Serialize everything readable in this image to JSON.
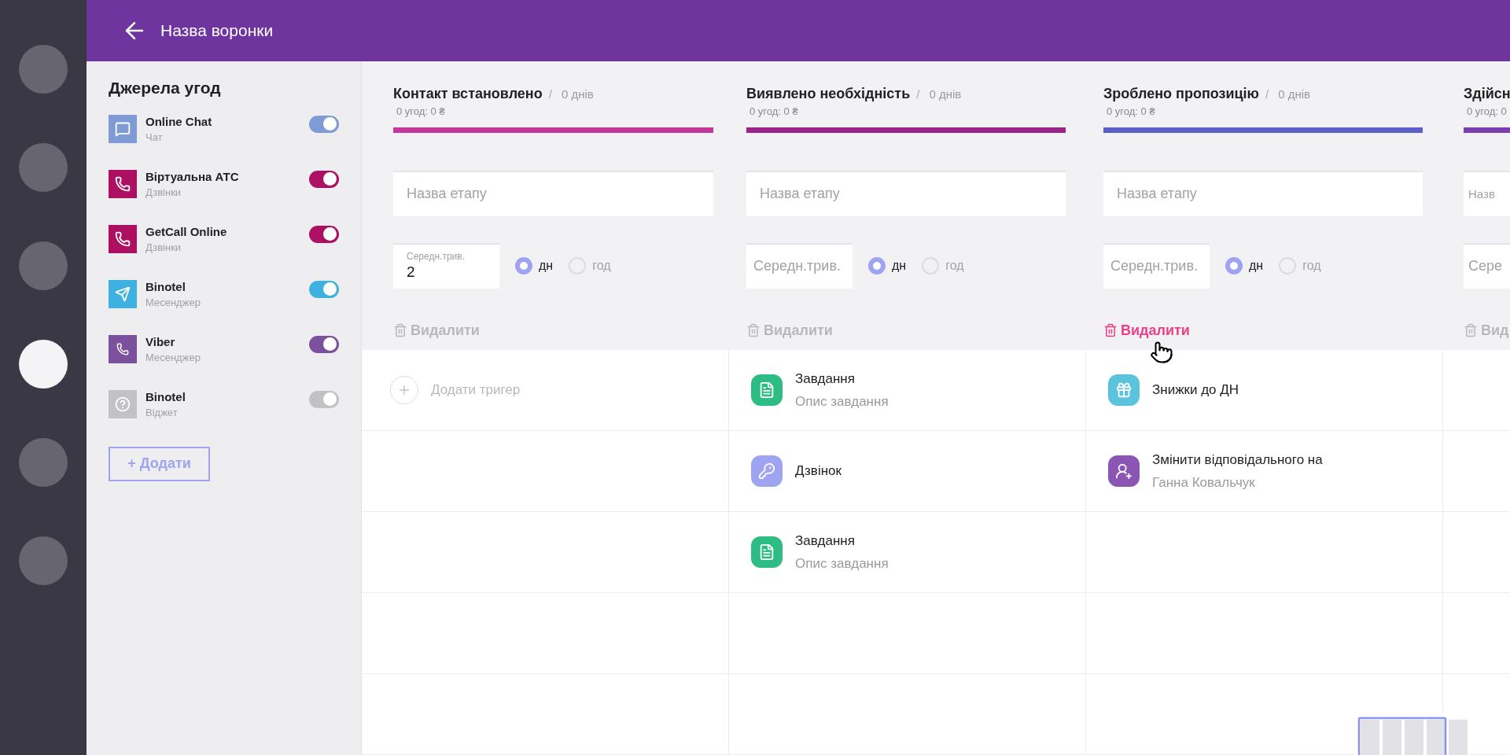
{
  "header": {
    "title": "Назва воронки"
  },
  "rail": [
    {
      "selected": false
    },
    {
      "selected": false
    },
    {
      "selected": false
    },
    {
      "selected": true
    },
    {
      "selected": false
    },
    {
      "selected": false
    }
  ],
  "sources": {
    "title": "Джерела угод",
    "items": [
      {
        "kind": "chat",
        "name": "Online Chat",
        "type": "Чат",
        "color": "#7f9bd6",
        "on": true
      },
      {
        "kind": "pbx",
        "name": "Віртуальна АТС",
        "type": "Дзвінки",
        "color": "#ad0f62",
        "on": true
      },
      {
        "kind": "phone",
        "name": "GetCall Online",
        "type": "Дзвінки",
        "color": "#ad0f62",
        "on": true
      },
      {
        "kind": "telegram",
        "name": "Binotel",
        "type": "Месенджер",
        "color": "#3eb1e0",
        "on": true
      },
      {
        "kind": "viber",
        "name": "Viber",
        "type": "Месенджер",
        "color": "#7b519d",
        "on": true
      },
      {
        "kind": "widget",
        "name": "Binotel",
        "type": "Віджет",
        "color": "#c2c2c4",
        "on": true
      }
    ],
    "add_button": "+ Додати"
  },
  "stages": [
    {
      "title": "Контакт встановлено",
      "separator": "/",
      "duration": "0 днів",
      "summary": "0 угод: 0 ₴",
      "color": "#c2399a",
      "name_placeholder": "Назва етапу",
      "duration_field": {
        "label": "Середн.трив.",
        "value": "2"
      },
      "units": [
        {
          "label": "дн",
          "selected": true
        },
        {
          "label": "год",
          "selected": false
        }
      ],
      "delete": {
        "label": "Видалити",
        "hover": false
      },
      "cards": [
        {
          "kind": "add",
          "title": "Додати тригер"
        }
      ]
    },
    {
      "title": "Виявлено необхідність",
      "separator": "/",
      "duration": "0 днів",
      "summary": "0 угод: 0 ₴",
      "color": "#9c2388",
      "name_placeholder": "Назва етапу",
      "duration_field": {
        "placeholder": "Середн.трив."
      },
      "units": [
        {
          "label": "дн",
          "selected": true
        },
        {
          "label": "год",
          "selected": false
        }
      ],
      "delete": {
        "label": "Видалити",
        "hover": false
      },
      "cards": [
        {
          "kind": "task",
          "title": "Завдання",
          "subtitle": "Опис завдання"
        },
        {
          "kind": "call",
          "title": "Дзвінок"
        },
        {
          "kind": "task",
          "title": "Завдання",
          "subtitle": "Опис завдання"
        }
      ]
    },
    {
      "title": "Зроблено пропозицію",
      "separator": "/",
      "duration": "0 днів",
      "summary": "0 угод: 0 ₴",
      "color": "#5b5fc7",
      "name_placeholder": "Назва етапу",
      "duration_field": {
        "placeholder": "Середн.трив."
      },
      "units": [
        {
          "label": "дн",
          "selected": true
        },
        {
          "label": "год",
          "selected": false
        }
      ],
      "delete": {
        "label": "Видалити",
        "hover": true
      },
      "cards": [
        {
          "kind": "gift",
          "title": "Знижки до ДН"
        },
        {
          "kind": "assign",
          "title": "Змінити відповідального на",
          "subtitle": "Ганна Ковальчук"
        }
      ]
    },
    {
      "title": "Здійсн",
      "summary": "0 угод: 0",
      "color": "#7b3fb0",
      "name_placeholder": "Назв",
      "duration_field": {
        "placeholder": "Сере"
      },
      "delete": {
        "label": "Вид",
        "hover": false
      }
    }
  ]
}
